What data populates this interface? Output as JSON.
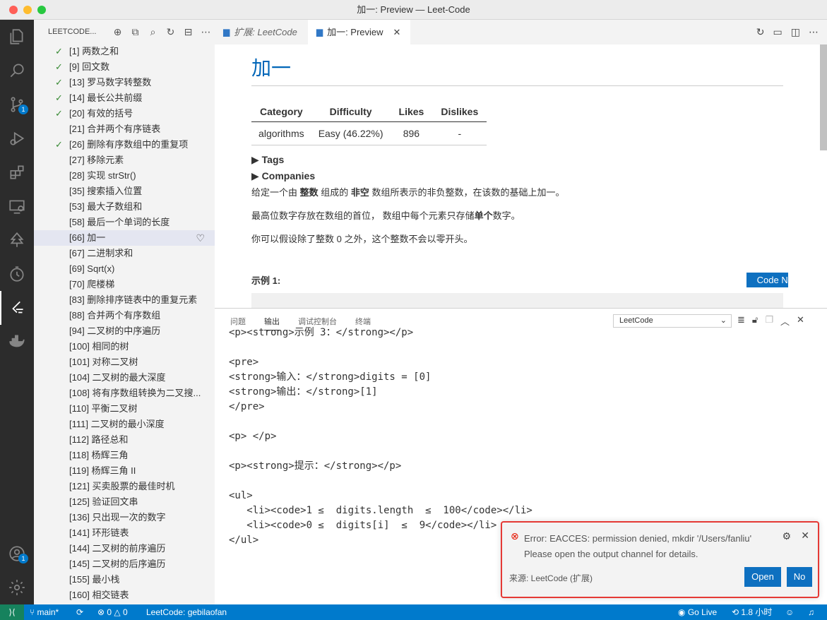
{
  "window": {
    "title": "加一: Preview — Leet-Code"
  },
  "activity": {
    "scm_badge": "1",
    "accounts_badge": "1"
  },
  "sidebar": {
    "title": "LEETCODE...",
    "items": [
      {
        "label": "[1] 两数之和",
        "solved": true
      },
      {
        "label": "[9] 回文数",
        "solved": true
      },
      {
        "label": "[13] 罗马数字转整数",
        "solved": true
      },
      {
        "label": "[14] 最长公共前缀",
        "solved": true
      },
      {
        "label": "[20] 有效的括号",
        "solved": true
      },
      {
        "label": "[21] 合并两个有序链表",
        "solved": false
      },
      {
        "label": "[26] 删除有序数组中的重复项",
        "solved": true
      },
      {
        "label": "[27] 移除元素",
        "solved": false
      },
      {
        "label": "[28] 实现 strStr()",
        "solved": false
      },
      {
        "label": "[35] 搜索插入位置",
        "solved": false
      },
      {
        "label": "[53] 最大子数组和",
        "solved": false
      },
      {
        "label": "[58] 最后一个单词的长度",
        "solved": false
      },
      {
        "label": "[66] 加一",
        "solved": false,
        "selected": true
      },
      {
        "label": "[67] 二进制求和",
        "solved": false
      },
      {
        "label": "[69] Sqrt(x)",
        "solved": false
      },
      {
        "label": "[70] 爬楼梯",
        "solved": false
      },
      {
        "label": "[83] 删除排序链表中的重复元素",
        "solved": false
      },
      {
        "label": "[88] 合并两个有序数组",
        "solved": false
      },
      {
        "label": "[94] 二叉树的中序遍历",
        "solved": false
      },
      {
        "label": "[100] 相同的树",
        "solved": false
      },
      {
        "label": "[101] 对称二叉树",
        "solved": false
      },
      {
        "label": "[104] 二叉树的最大深度",
        "solved": false
      },
      {
        "label": "[108] 将有序数组转换为二叉搜...",
        "solved": false
      },
      {
        "label": "[110] 平衡二叉树",
        "solved": false
      },
      {
        "label": "[111] 二叉树的最小深度",
        "solved": false
      },
      {
        "label": "[112] 路径总和",
        "solved": false
      },
      {
        "label": "[118] 杨辉三角",
        "solved": false
      },
      {
        "label": "[119] 杨辉三角 II",
        "solved": false
      },
      {
        "label": "[121] 买卖股票的最佳时机",
        "solved": false
      },
      {
        "label": "[125] 验证回文串",
        "solved": false
      },
      {
        "label": "[136] 只出现一次的数字",
        "solved": false
      },
      {
        "label": "[141] 环形链表",
        "solved": false
      },
      {
        "label": "[144] 二叉树的前序遍历",
        "solved": false
      },
      {
        "label": "[145] 二叉树的后序遍历",
        "solved": false
      },
      {
        "label": "[155] 最小栈",
        "solved": false
      },
      {
        "label": "[160] 相交链表",
        "solved": false
      }
    ]
  },
  "tabs": [
    {
      "label": "扩展: LeetCode"
    },
    {
      "label": "加一: Preview"
    }
  ],
  "preview": {
    "title": "加一",
    "table_headers": [
      "Category",
      "Difficulty",
      "Likes",
      "Dislikes"
    ],
    "table_row": [
      "algorithms",
      "Easy (46.22%)",
      "896",
      "-"
    ],
    "tags": "Tags",
    "companies": "Companies",
    "p1_a": "给定一个由 ",
    "p1_b": "整数",
    "p1_c": " 组成的 ",
    "p1_d": "非空",
    "p1_e": " 数组所表示的非负整数，在该数的基础上加一。",
    "p2_a": "最高位数字存放在数组的首位， 数组中每个元素只存储",
    "p2_b": "单个",
    "p2_c": "数字。",
    "p3": "你可以假设除了整数 0 之外，这个整数不会以零开头。",
    "example": "示例 1:",
    "code_now": "Code Now"
  },
  "panel": {
    "tabs": [
      "问题",
      "输出",
      "调试控制台",
      "终端"
    ],
    "select": "LeetCode",
    "output": "<p><strong>示例 3：</strong></p>\n\n<pre>\n<strong>输入：</strong>digits = [0]\n<strong>输出：</strong>[1]\n</pre>\n\n<p> </p>\n\n<p><strong>提示：</strong></p>\n\n<ul>\n   <li><code>1 ≤  digits.length  ≤  100</code></li>\n   <li><code>0 ≤  digits[i]  ≤  9</code></li>\n</ul>"
  },
  "notification": {
    "line1": "Error: EACCES: permission denied, mkdir '/Users/fanliu'",
    "line2": "Please open the output channel for details.",
    "source": "来源: LeetCode (扩展)",
    "open": "Open",
    "no": "No"
  },
  "status": {
    "branch": "main*",
    "errors": "0",
    "warnings": "0",
    "leetcode": "LeetCode: gebilaofan",
    "golive": "Go Live",
    "time": "1.8 小时"
  }
}
